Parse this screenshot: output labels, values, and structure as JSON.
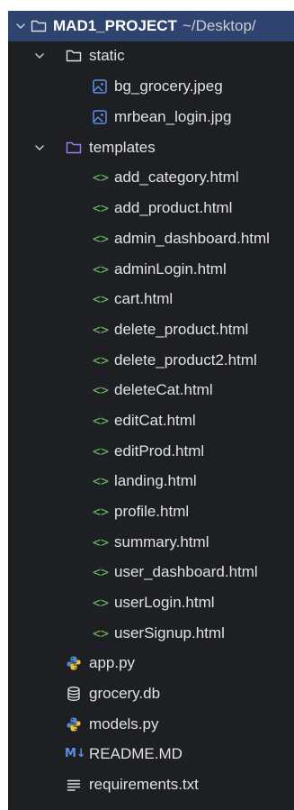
{
  "project": {
    "name": "MAD1_PROJECT",
    "path": "~/Desktop/"
  },
  "tree": {
    "static": {
      "name": "static",
      "files": [
        "bg_grocery.jpeg",
        "mrbean_login.jpg"
      ]
    },
    "templates": {
      "name": "templates",
      "files": [
        "add_category.html",
        "add_product.html",
        "admin_dashboard.html",
        "adminLogin.html",
        "cart.html",
        "delete_product.html",
        "delete_product2.html",
        "deleteCat.html",
        "editCat.html",
        "editProd.html",
        "landing.html",
        "profile.html",
        "summary.html",
        "user_dashboard.html",
        "userLogin.html",
        "userSignup.html"
      ]
    },
    "root_files": {
      "app": "app.py",
      "db": "grocery.db",
      "models": "models.py",
      "readme": "README.MD",
      "requirements": "requirements.txt"
    }
  },
  "icons": {
    "html_tag": "<>",
    "markdown": "M↓"
  },
  "colors": {
    "background": "#1e1f22",
    "selection": "#2e436e",
    "text": "#dfe1e5",
    "html_icon": "#6fb866",
    "image_icon": "#5c8ee6",
    "templates_folder": "#a77bf3"
  }
}
